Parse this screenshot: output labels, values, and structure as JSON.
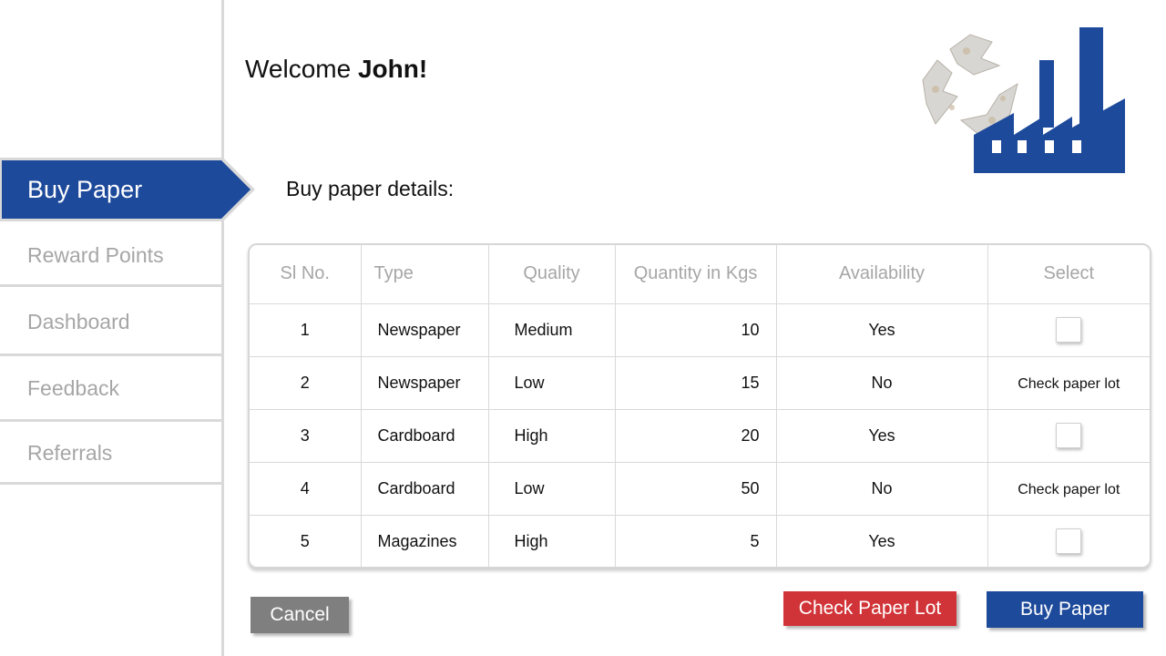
{
  "colors": {
    "brand_blue": "#1e4a9b",
    "danger_red": "#d13438",
    "neutral_gray": "#7f7f7f",
    "muted_text": "#a6a6a6"
  },
  "sidebar": {
    "active_item": "Buy Paper",
    "items": [
      {
        "label": "Reward Points"
      },
      {
        "label": "Dashboard"
      },
      {
        "label": "Feedback"
      },
      {
        "label": "Referrals"
      }
    ]
  },
  "header": {
    "welcome_prefix": "Welcome ",
    "user_name": "John!",
    "logo_icon": "recycle-factory-icon"
  },
  "section_title": "Buy paper details:",
  "table": {
    "columns": [
      "Sl No.",
      "Type",
      "Quality",
      "Quantity in Kgs",
      "Availability",
      "Select"
    ],
    "rows": [
      {
        "sl": "1",
        "type": "Newspaper",
        "quality": "Medium",
        "qty": "10",
        "availability": "Yes",
        "select": {
          "kind": "checkbox",
          "checked": false
        }
      },
      {
        "sl": "2",
        "type": "Newspaper",
        "quality": "Low",
        "qty": "15",
        "availability": "No",
        "select": {
          "kind": "link",
          "label": "Check paper lot"
        }
      },
      {
        "sl": "3",
        "type": "Cardboard",
        "quality": "High",
        "qty": "20",
        "availability": "Yes",
        "select": {
          "kind": "checkbox",
          "checked": false
        }
      },
      {
        "sl": "4",
        "type": "Cardboard",
        "quality": "Low",
        "qty": "50",
        "availability": "No",
        "select": {
          "kind": "link",
          "label": "Check paper lot"
        }
      },
      {
        "sl": "5",
        "type": "Magazines",
        "quality": "High",
        "qty": "5",
        "availability": "Yes",
        "select": {
          "kind": "checkbox",
          "checked": false
        }
      }
    ]
  },
  "buttons": {
    "cancel": "Cancel",
    "check_lot": "Check Paper Lot",
    "buy": "Buy Paper"
  }
}
